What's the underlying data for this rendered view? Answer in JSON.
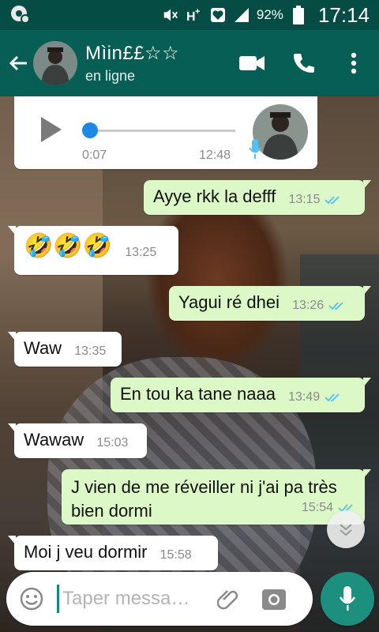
{
  "status_bar": {
    "battery_pct": "92%",
    "time": "17:14",
    "icons": [
      "notification-icon",
      "mute-icon",
      "h-plus-data-icon",
      "heart-icon",
      "signal-icon",
      "battery-icon"
    ]
  },
  "header": {
    "contact_name": "Mìin££☆☆",
    "contact_status": "en ligne",
    "icons": [
      "back-arrow-icon",
      "video-call-icon",
      "phone-icon",
      "more-options-icon"
    ]
  },
  "voice_message": {
    "duration": "0:07",
    "time": "12:48",
    "progress": 0.0
  },
  "messages": [
    {
      "direction": "out",
      "text": "Ayye rkk la defff",
      "time": "13:15",
      "read": true
    },
    {
      "direction": "in",
      "text": "🤣🤣🤣",
      "time": "13:25"
    },
    {
      "direction": "out",
      "text": "Yagui ré dhei",
      "time": "13:26",
      "read": true
    },
    {
      "direction": "in",
      "text": "Waw",
      "time": "13:35"
    },
    {
      "direction": "out",
      "text": "En tou ka tane naaa",
      "time": "13:49",
      "read": true
    },
    {
      "direction": "in",
      "text": "Wawaw",
      "time": "15:03"
    },
    {
      "direction": "out",
      "text": "J vien de me réveiller ni j'ai pa très bien dormi",
      "time": "15:54",
      "read": true
    },
    {
      "direction": "in",
      "text": "Moi j veu dormir",
      "time": "15:58"
    }
  ],
  "composer": {
    "placeholder": "Taper messa…"
  },
  "colors": {
    "header": "#075e54",
    "status_bar": "#054d44",
    "outgoing_bubble": "#dcf8c6",
    "incoming_bubble": "#ffffff",
    "accent": "#1d8f7f",
    "read_ticks": "#4fc3f7"
  }
}
